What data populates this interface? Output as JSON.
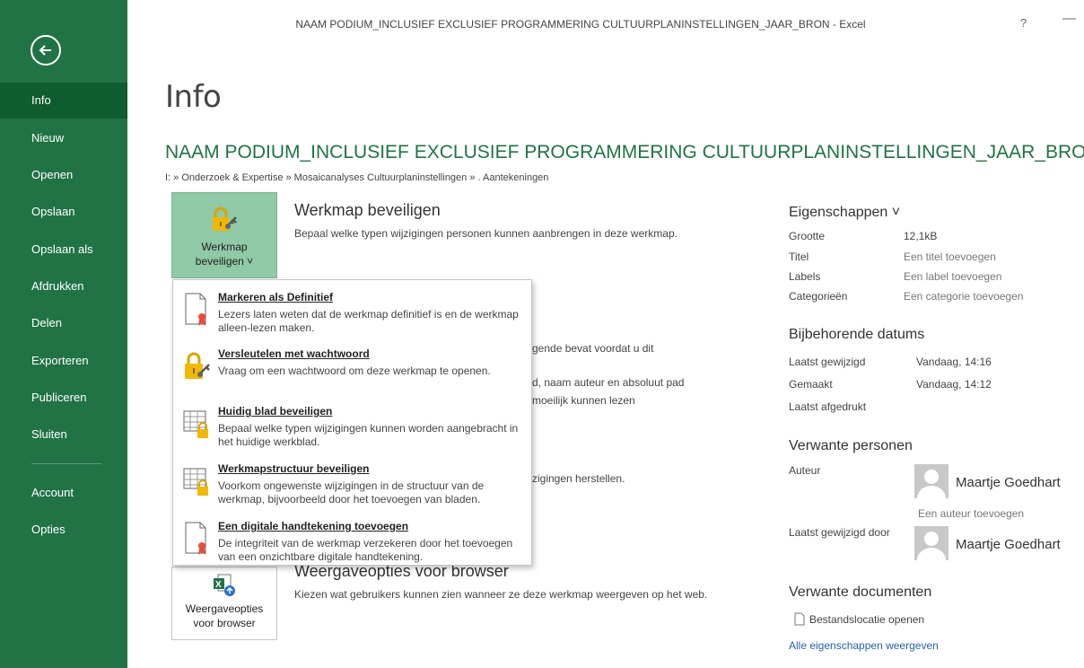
{
  "window": {
    "title": "NAAM PODIUM_INCLUSIEF EXCLUSIEF PROGRAMMERING CULTUURPLANINSTELLINGEN_JAAR_BRON - Excel",
    "help": "?",
    "minimize": "—"
  },
  "colors": {
    "brand": "#217346",
    "active": "#0e5c2f",
    "pressed": "#8fc9a5",
    "link": "#2a5fa8"
  },
  "sidebar": {
    "back_icon": "back-arrow-icon",
    "items": [
      {
        "label": "Info"
      },
      {
        "label": "Nieuw"
      },
      {
        "label": "Openen"
      },
      {
        "label": "Opslaan"
      },
      {
        "label": "Opslaan als"
      },
      {
        "label": "Afdrukken"
      },
      {
        "label": "Delen"
      },
      {
        "label": "Exporteren"
      },
      {
        "label": "Publiceren"
      },
      {
        "label": "Sluiten"
      },
      {
        "label": "Account"
      },
      {
        "label": "Opties"
      }
    ]
  },
  "main": {
    "page_title": "Info",
    "doc_title": "NAAM PODIUM_INCLUSIEF EXCLUSIEF PROGRAMMERING CULTUURPLANINSTELLINGEN_JAAR_BRON",
    "path": "I: » Onderzoek & Expertise » Mosaicanalyses Cultuurplaninstellingen » . Aantekeningen",
    "protect": {
      "button_label_1": "Werkmap",
      "button_label_2": "beveiligen ˅",
      "title": "Werkmap beveiligen",
      "desc": "Bepaal welke typen wijzigingen personen kunnen aanbrengen in deze werkmap."
    },
    "partials": {
      "p1": "gende bevat voordat u dit",
      "p2": "d, naam auteur en absoluut pad",
      "p3": "moeilijk kunnen lezen",
      "p4": "zigingen herstellen."
    },
    "browser": {
      "button_label_1": "Weergaveopties",
      "button_label_2": "voor browser",
      "title": "Weergaveopties voor browser",
      "desc": "Kiezen wat gebruikers kunnen zien wanneer ze deze werkmap weergeven op het web."
    }
  },
  "dropdown": {
    "items": [
      {
        "title": "Markeren als Definitief",
        "desc": "Lezers laten weten dat de werkmap definitief is en de werkmap alleen-lezen maken."
      },
      {
        "title": "Versleutelen met wachtwoord",
        "desc": "Vraag om een wachtwoord om deze werkmap te openen."
      },
      {
        "title": "Huidig blad beveiligen",
        "desc": "Bepaal welke typen wijzigingen kunnen worden aangebracht in het huidige werkblad."
      },
      {
        "title": "Werkmapstructuur beveiligen",
        "desc": "Voorkom ongewenste wijzigingen in de structuur van de werkmap, bijvoorbeeld door het toevoegen van bladen."
      },
      {
        "title": "Een digitale handtekening toevoegen",
        "desc": "De integriteit van de werkmap verzekeren door het toevoegen van een onzichtbare digitale handtekening."
      }
    ]
  },
  "properties": {
    "title": "Eigenschappen ˅",
    "rows": [
      {
        "label": "Grootte",
        "value": "12,1kB"
      },
      {
        "label": "Titel",
        "value": "Een titel toevoegen"
      },
      {
        "label": "Labels",
        "value": "Een label toevoegen"
      },
      {
        "label": "Categorieën",
        "value": "Een categorie toevoegen"
      }
    ]
  },
  "dates": {
    "title": "Bijbehorende datums",
    "rows": [
      {
        "label": "Laatst gewijzigd",
        "value": "Vandaag, 14:16"
      },
      {
        "label": "Gemaakt",
        "value": "Vandaag, 14:12"
      },
      {
        "label": "Laatst afgedrukt",
        "value": ""
      }
    ]
  },
  "people": {
    "title": "Verwante personen",
    "author_label": "Auteur",
    "author_name": "Maartje Goedhart",
    "add_author": "Een auteur toevoegen",
    "modified_label": "Laatst gewijzigd door",
    "modified_name": "Maartje Goedhart"
  },
  "documents": {
    "title": "Verwante documenten",
    "open_location": "Bestandslocatie openen",
    "all_properties": "Alle eigenschappen weergeven"
  }
}
